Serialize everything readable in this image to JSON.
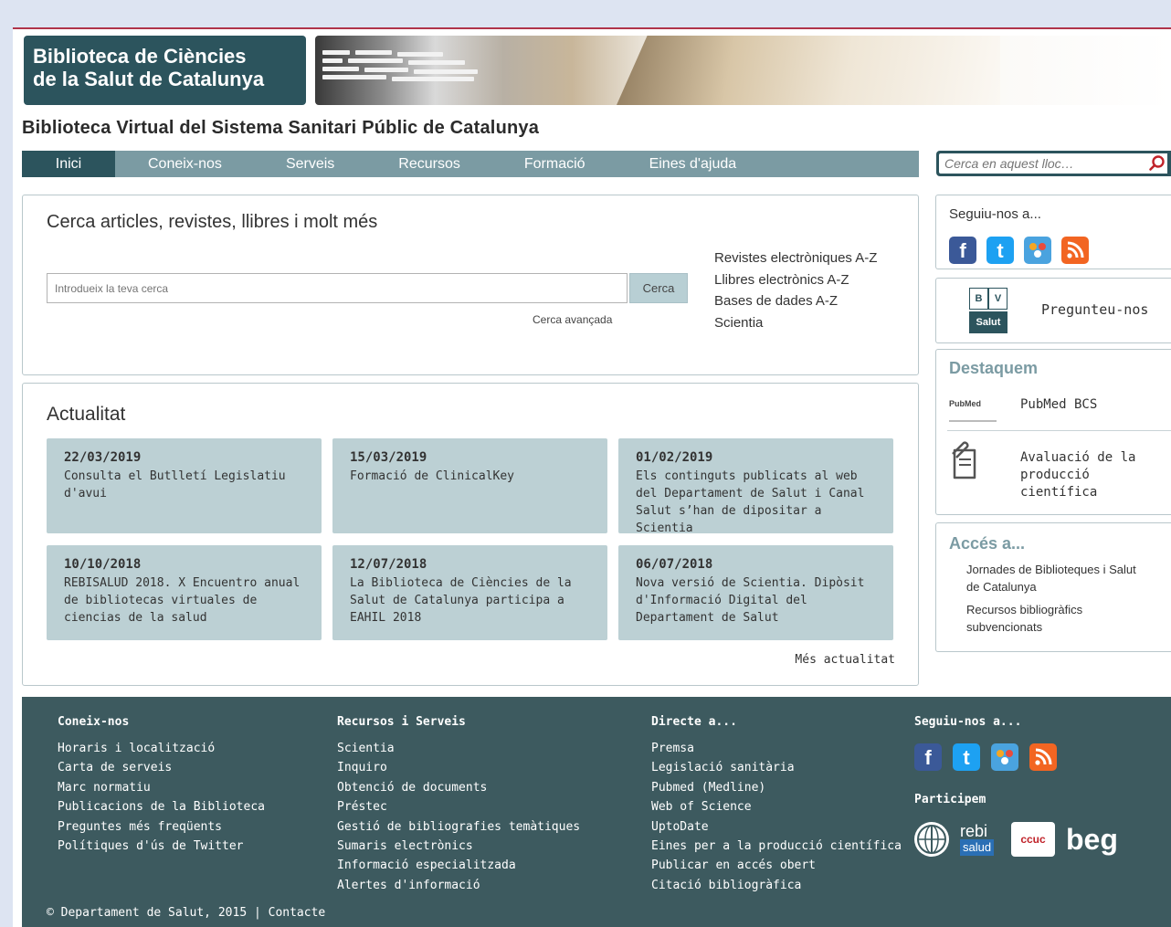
{
  "header": {
    "logo_line1": "Biblioteca de Ciències",
    "logo_line2": "de la Salut de Catalunya",
    "site_title": "Biblioteca Virtual del Sistema Sanitari Públic de Catalunya"
  },
  "nav": {
    "items": [
      {
        "label": "Inici",
        "active": true
      },
      {
        "label": "Coneix-nos"
      },
      {
        "label": "Serveis"
      },
      {
        "label": "Recursos"
      },
      {
        "label": "Formació"
      },
      {
        "label": "Eines d'ajuda"
      }
    ],
    "site_search_placeholder": "Cerca en aquest lloc…"
  },
  "search_panel": {
    "heading": "Cerca articles, revistes, llibres i molt més",
    "input_placeholder": "Introdueix la teva cerca",
    "button_label": "Cerca",
    "advanced_link": "Cerca avançada",
    "quick_links": [
      "Revistes electròniques A-Z",
      "Llibres electrònics A-Z",
      "Bases de dades A-Z",
      "Scientia"
    ]
  },
  "news": {
    "heading": "Actualitat",
    "items": [
      {
        "date": "22/03/2019",
        "text": "Consulta el Butlletí Legislatiu d'avui"
      },
      {
        "date": "15/03/2019",
        "text": "Formació de ClinicalKey"
      },
      {
        "date": "01/02/2019",
        "text": "Els continguts publicats al web del Departament de Salut i Canal Salut s’han de dipositar a Scientia"
      },
      {
        "date": "10/10/2018",
        "text": "REBISALUD 2018. X Encuentro anual de bibliotecas virtuales de ciencias de la salud"
      },
      {
        "date": "12/07/2018",
        "text": "La Biblioteca de Ciències de la Salut de Catalunya participa a EAHIL 2018"
      },
      {
        "date": "06/07/2018",
        "text": "Nova versió de Scientia. Dipòsit d'Informació Digital del Departament de Salut"
      }
    ],
    "more_link": "Més actualitat"
  },
  "sidebar": {
    "follow_title": "Seguiu-nos a...",
    "ask_label": "Pregunteu-nos",
    "bv_top_left": "B",
    "bv_top_right": "V",
    "bv_bottom": "Salut",
    "highlight_title": "Destaquem",
    "pubmed_logo": "PubMed",
    "pubmed_label": "PubMed BCS",
    "evaluation_label": "Avaluació de la producció científica",
    "access_title": "Accés a...",
    "access_links": [
      "Jornades de Biblioteques i Salut de Catalunya",
      "Recursos bibliogràfics subvencionats"
    ]
  },
  "footer": {
    "columns": [
      {
        "title": "Coneix-nos",
        "links": [
          "Horaris i localització",
          "Carta de serveis",
          "Marc normatiu",
          "Publicacions de la Biblioteca",
          "Preguntes més freqüents",
          "Polítiques d'ús de Twitter"
        ]
      },
      {
        "title": "Recursos i Serveis",
        "links": [
          "Scientia",
          "Inquiro",
          "Obtenció de documents",
          "Préstec",
          "Gestió de bibliografies temàtiques",
          "Sumaris electrònics",
          "Informació especialitzada",
          "Alertes d'informació"
        ]
      },
      {
        "title": "Directe a...",
        "links": [
          "Premsa",
          "Legislació sanitària",
          "Pubmed (Medline)",
          "Web of Science",
          "UptoDate",
          "Eines per a la producció científica",
          "Publicar en accés obert",
          "Citació bibliogràfica"
        ]
      }
    ],
    "follow_title": "Seguiu-nos a...",
    "participate_title": "Participem",
    "logo_rebi_top": "rebi",
    "logo_rebi_bottom": "salud",
    "logo_ccuc": "ccuc",
    "logo_beg": "beg",
    "copyright": "© Departament de Salut, 2015 | Contacte"
  },
  "colors": {
    "brand_dark": "#2c545d",
    "nav_bar": "#7b9ba3",
    "card": "#bcd0d4",
    "footer": "#3d5a5f",
    "facebook": "#3b5998",
    "twitter": "#1da1f2",
    "rss": "#f26522"
  }
}
